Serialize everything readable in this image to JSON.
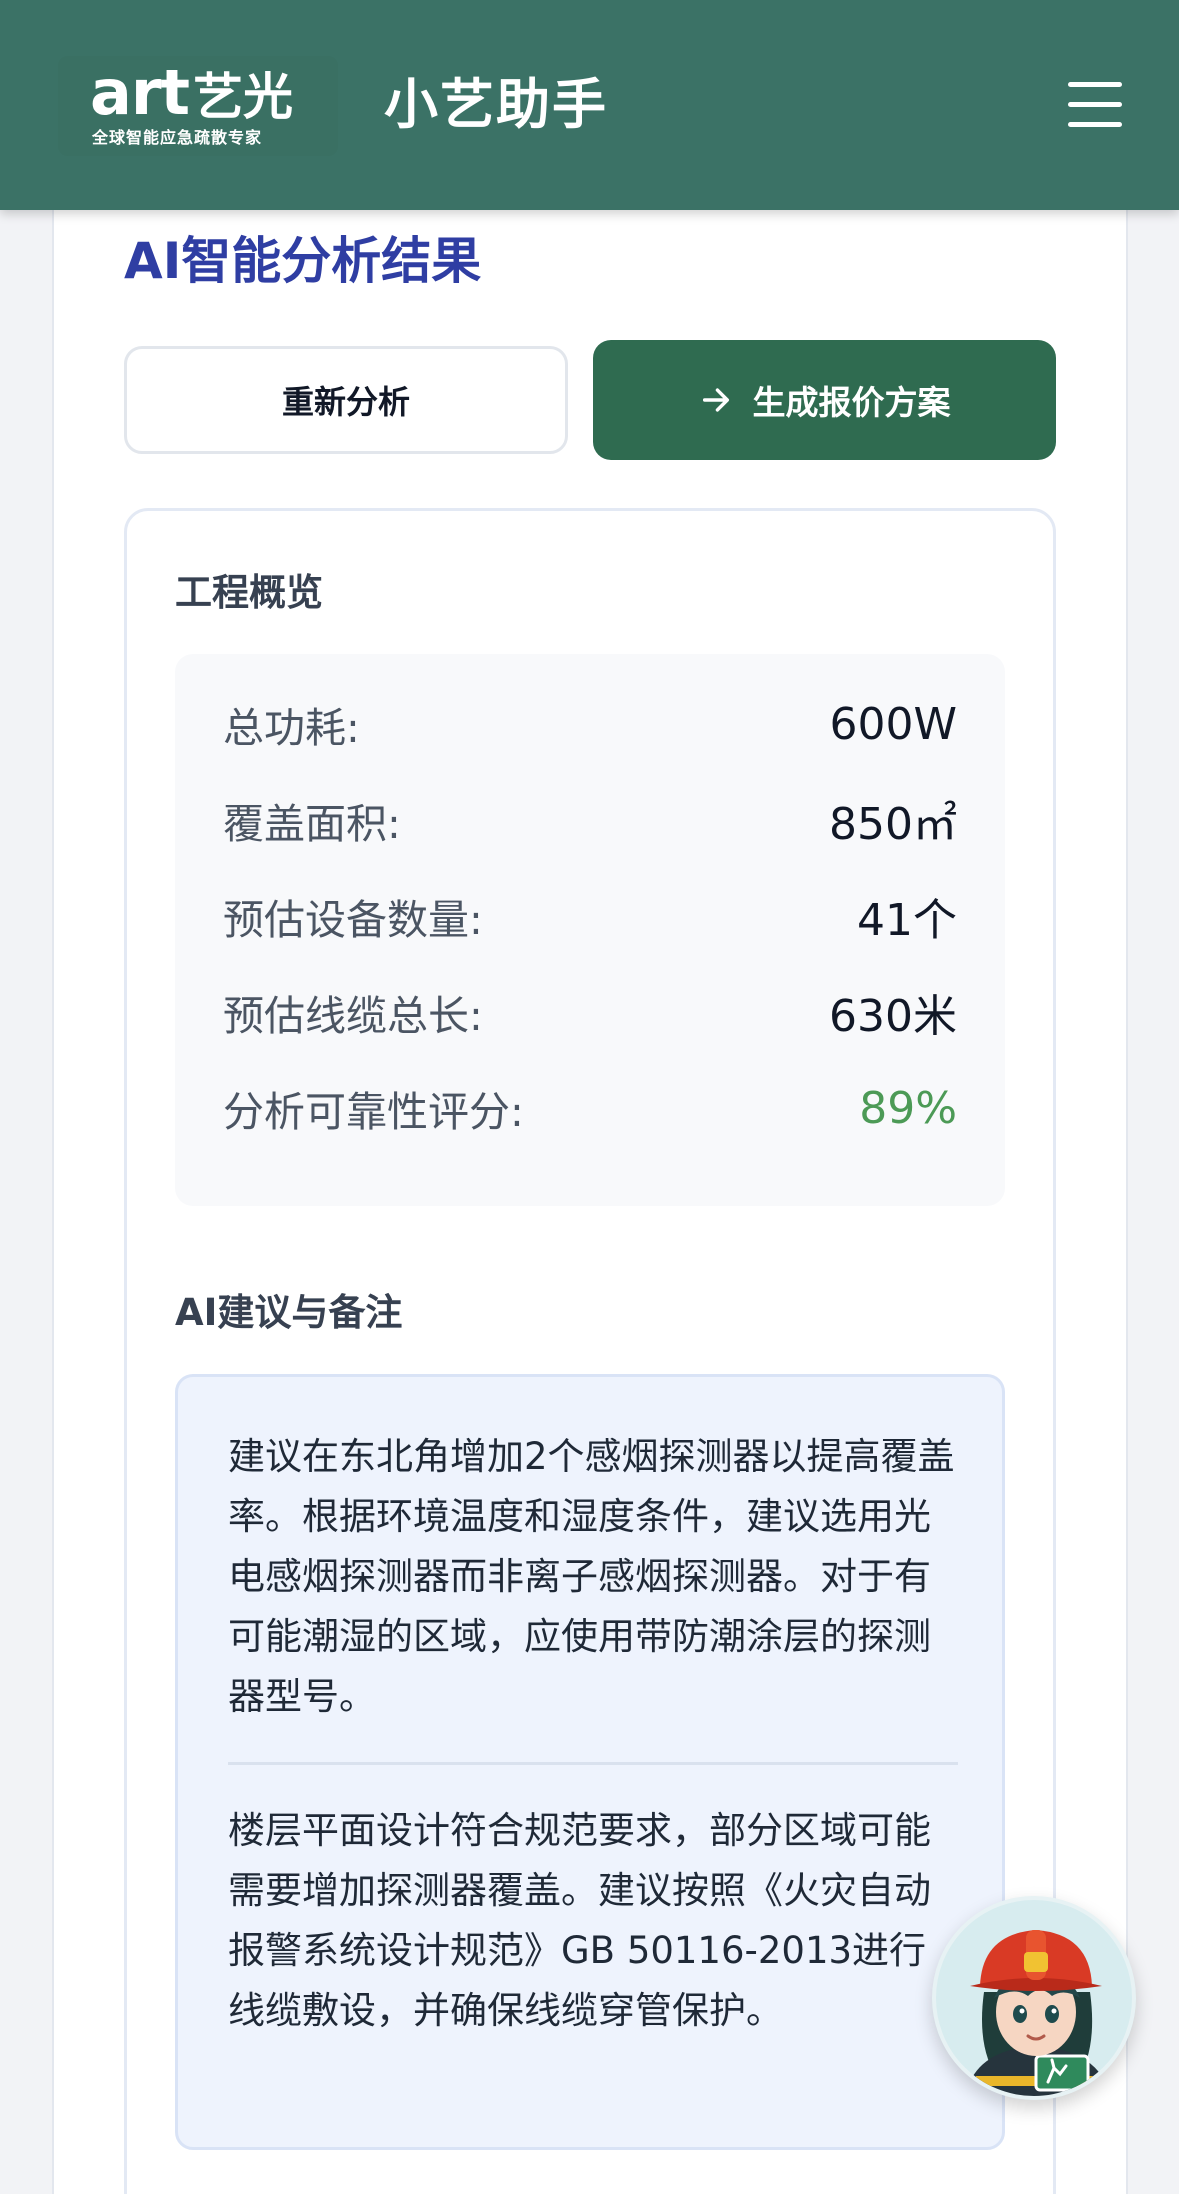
{
  "header": {
    "logo": {
      "main": "art",
      "cn": "艺光",
      "tagline": "全球智能应急疏散专家"
    },
    "title": "小艺助手",
    "menu_icon": "hamburger-menu-icon",
    "background_color": "#3b7266"
  },
  "main": {
    "section_title": "AI智能分析结果",
    "buttons": {
      "reanalyze": "重新分析",
      "generate_quote": "生成报价方案",
      "generate_quote_icon": "arrow-right-icon"
    },
    "overview": {
      "title": "工程概览",
      "stats": [
        {
          "label": "总功耗:",
          "value": "600W"
        },
        {
          "label": "覆盖面积:",
          "value": "850㎡"
        },
        {
          "label": "预估设备数量:",
          "value": "41个"
        },
        {
          "label": "预估线缆总长:",
          "value": "630米"
        },
        {
          "label": "分析可靠性评分:",
          "value": "89%"
        }
      ]
    },
    "suggestions": {
      "title": "AI建议与备注",
      "items": [
        "建议在东北角增加2个感烟探测器以提高覆盖率。根据环境温度和湿度条件，建议选用光电感烟探测器而非离子感烟探测器。对于有可能潮湿的区域，应使用带防潮涂层的探测器型号。",
        "楼层平面设计符合规范要求，部分区域可能需要增加探测器覆盖。建议按照《火灾自动报警系统设计规范》GB 50116-2013进行线缆敷设，并确保线缆穿管保护。"
      ]
    }
  },
  "assistant": {
    "icon": "firefighter-assistant-avatar"
  },
  "colors": {
    "primary": "#2f6b50",
    "title": "#2f3ea3",
    "good": "#4c9a56",
    "notes_bg": "#eef3fd"
  }
}
